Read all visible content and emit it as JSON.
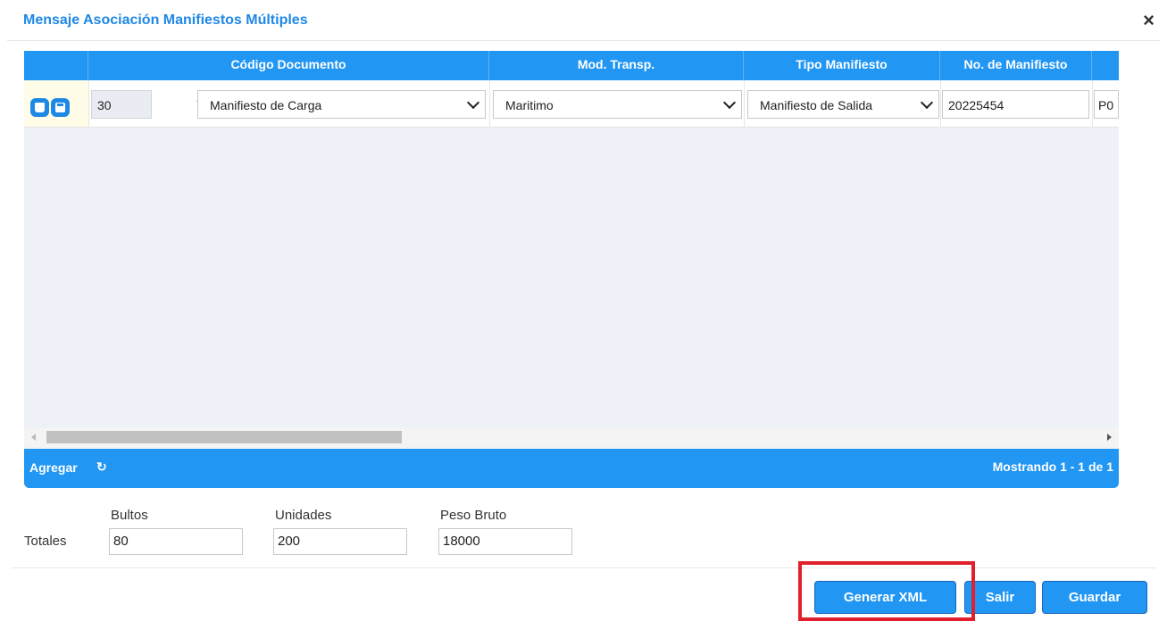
{
  "dialog": {
    "title": "Mensaje Asociación Manifiestos Múltiples",
    "close_icon": "×"
  },
  "grid": {
    "columns": [
      "Código Documento",
      "Mod. Transp.",
      "Tipo Manifiesto",
      "No. de Manifiesto"
    ],
    "row": {
      "codigo": "30",
      "separator": "-",
      "documento_select": "Manifiesto de Carga",
      "mod_transp_select": "Maritimo",
      "tipo_manifiesto_select": "Manifiesto de Salida",
      "no_manifiesto": "20225454",
      "next_col_partial": "P0"
    },
    "footer": {
      "add_label": "Agregar",
      "refresh_icon": "↻",
      "record_count": "Mostrando 1 - 1 de 1"
    }
  },
  "totals": {
    "label": "Totales",
    "bultos_label": "Bultos",
    "bultos_value": "80",
    "unidades_label": "Unidades",
    "unidades_value": "200",
    "peso_label": "Peso Bruto",
    "peso_value": "18000"
  },
  "actions": {
    "generar_xml": "Generar XML",
    "salir": "Salir",
    "guardar": "Guardar"
  },
  "colors": {
    "accent": "#2196f3",
    "title": "#1e88e5",
    "highlight": "#e0202c"
  }
}
